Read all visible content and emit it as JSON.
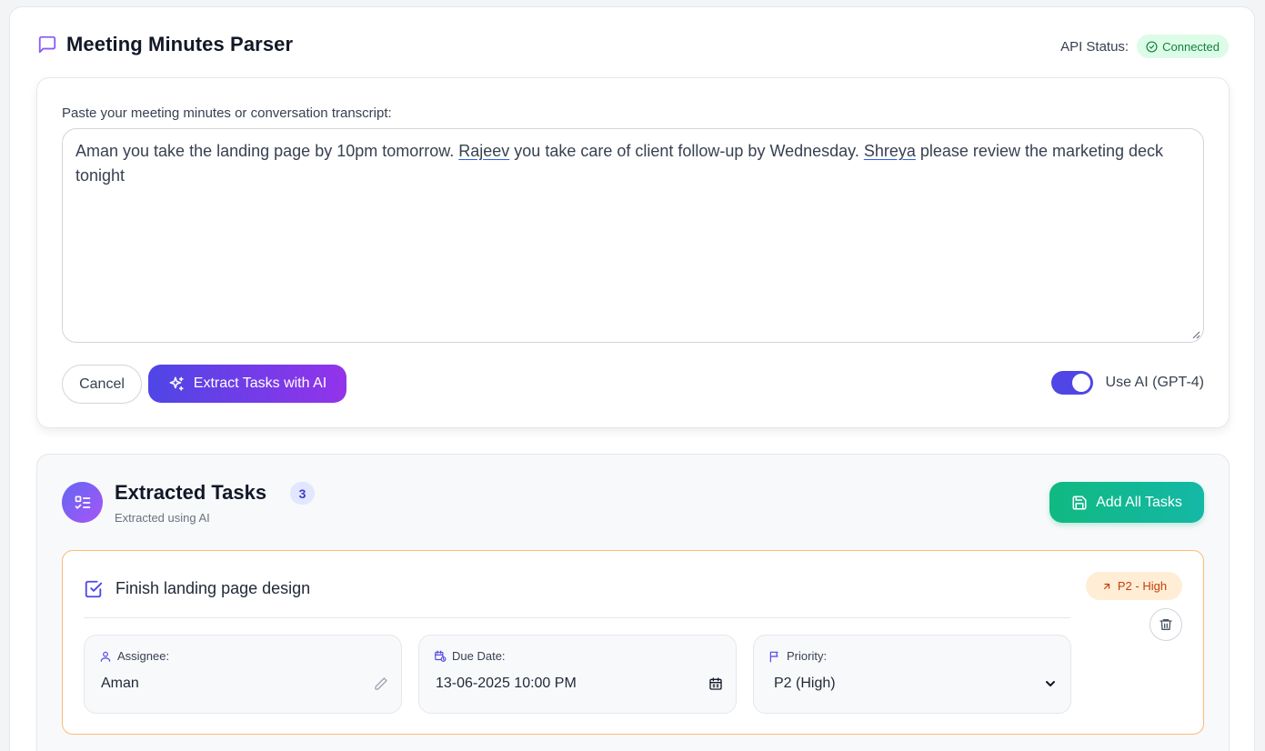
{
  "header": {
    "title": "Meeting Minutes Parser",
    "api_status_label": "API Status:",
    "api_status_value": "Connected"
  },
  "input_card": {
    "label": "Paste your meeting minutes or conversation transcript:",
    "transcript_parts": {
      "p1": "Aman you take the landing page by 10pm tomorrow. ",
      "p2": "Rajeev",
      "p3": " you take care of client follow-up by Wednesday. ",
      "p4": "Shreya",
      "p5": " please review the marketing deck tonight"
    },
    "cancel_label": "Cancel",
    "extract_label": "Extract Tasks with AI",
    "toggle_label": "Use AI (GPT-4)",
    "toggle_on": true
  },
  "tasks": {
    "title": "Extracted Tasks",
    "count": "3",
    "subtitle": "Extracted using AI",
    "add_all_label": "Add All Tasks",
    "items": [
      {
        "title": "Finish landing page design",
        "priority_badge": "P2 - High",
        "assignee_label": "Assignee:",
        "assignee": "Aman",
        "due_label": "Due Date:",
        "due": "13-06-2025 10:00 PM",
        "priority_label": "Priority:",
        "priority": "P2 (High)"
      }
    ]
  },
  "colors": {
    "accent": "#4f46e5",
    "accent_purple": "#9333ea",
    "success": "#10b981",
    "priority_high_bg": "#ffedd5",
    "priority_high_text": "#c2410c",
    "connected_bg": "#dcfce7"
  },
  "icons": {
    "title": "message-square-icon",
    "status": "check-circle-icon",
    "extract": "sparkles-icon",
    "tasks": "list-checks-icon",
    "add_all": "save-icon",
    "task_check": "square-check-icon",
    "priority": "arrow-up-right-icon",
    "delete": "trash-icon",
    "assignee": "user-icon",
    "due": "calendar-clock-icon",
    "priority_field": "flag-icon",
    "edit": "pencil-icon",
    "calendar": "calendar-icon",
    "dropdown": "chevron-down-icon"
  }
}
